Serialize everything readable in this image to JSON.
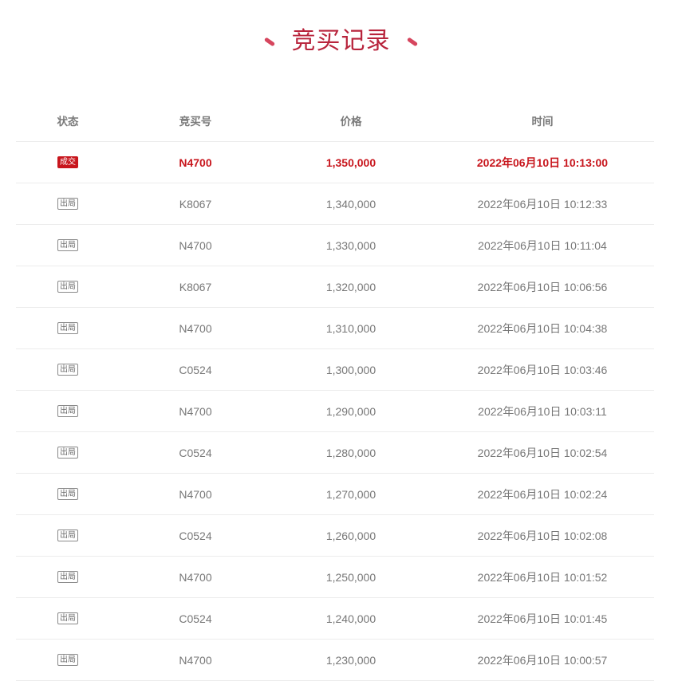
{
  "page": {
    "title": "竞买记录"
  },
  "table": {
    "headers": {
      "status": "状态",
      "bidder": "竞买号",
      "price": "价格",
      "time": "时间"
    },
    "rows": [
      {
        "status": "成交",
        "bidder": "N4700",
        "price": "1,350,000",
        "time": "2022年06月10日 10:13:00"
      },
      {
        "status": "出局",
        "bidder": "K8067",
        "price": "1,340,000",
        "time": "2022年06月10日 10:12:33"
      },
      {
        "status": "出局",
        "bidder": "N4700",
        "price": "1,330,000",
        "time": "2022年06月10日 10:11:04"
      },
      {
        "status": "出局",
        "bidder": "K8067",
        "price": "1,320,000",
        "time": "2022年06月10日 10:06:56"
      },
      {
        "status": "出局",
        "bidder": "N4700",
        "price": "1,310,000",
        "time": "2022年06月10日 10:04:38"
      },
      {
        "status": "出局",
        "bidder": "C0524",
        "price": "1,300,000",
        "time": "2022年06月10日 10:03:46"
      },
      {
        "status": "出局",
        "bidder": "N4700",
        "price": "1,290,000",
        "time": "2022年06月10日 10:03:11"
      },
      {
        "status": "出局",
        "bidder": "C0524",
        "price": "1,280,000",
        "time": "2022年06月10日 10:02:54"
      },
      {
        "status": "出局",
        "bidder": "N4700",
        "price": "1,270,000",
        "time": "2022年06月10日 10:02:24"
      },
      {
        "status": "出局",
        "bidder": "C0524",
        "price": "1,260,000",
        "time": "2022年06月10日 10:02:08"
      },
      {
        "status": "出局",
        "bidder": "N4700",
        "price": "1,250,000",
        "time": "2022年06月10日 10:01:52"
      },
      {
        "status": "出局",
        "bidder": "C0524",
        "price": "1,240,000",
        "time": "2022年06月10日 10:01:45"
      },
      {
        "status": "出局",
        "bidder": "N4700",
        "price": "1,230,000",
        "time": "2022年06月10日 10:00:57"
      }
    ]
  },
  "colors": {
    "title": "#b8243c",
    "winner": "#c8161d",
    "text": "#777777",
    "divider": "#ececec"
  }
}
